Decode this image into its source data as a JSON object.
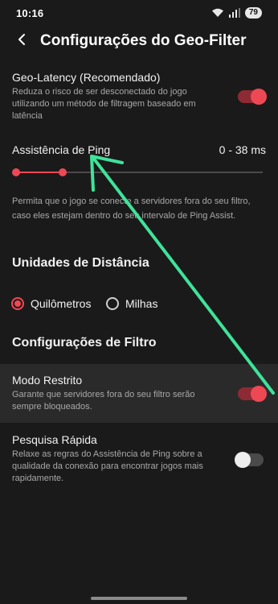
{
  "status": {
    "time": "10:16",
    "battery": "79"
  },
  "header": {
    "title": "Configurações do Geo-Filter"
  },
  "geo_latency": {
    "title": "Geo-Latency (Recomendado)",
    "description": "Reduza o risco de ser desconectado do jogo utilizando um método de filtragem baseado em latência",
    "enabled": true
  },
  "ping_assist": {
    "title": "Assistência de Ping",
    "range_label": "0 - 38 ms",
    "description": "Permita que o jogo se conecte a servidores fora do seu filtro, caso eles estejam dentro do seu intervalo de Ping Assist."
  },
  "distance_units": {
    "title": "Unidades de Distância",
    "options": [
      {
        "label": "Quilômetros",
        "selected": true
      },
      {
        "label": "Milhas",
        "selected": false
      }
    ]
  },
  "filter_settings": {
    "title": "Configurações de Filtro"
  },
  "restricted_mode": {
    "title": "Modo Restrito",
    "description": "Garante que servidores fora do seu filtro serão sempre bloqueados.",
    "enabled": true
  },
  "quick_search": {
    "title": "Pesquisa Rápida",
    "description": "Relaxe as regras do Assistência de Ping sobre a qualidade da conexão para encontrar jogos mais rapidamente.",
    "enabled": false
  },
  "colors": {
    "accent": "#ef4855",
    "arrow": "#3fe39a",
    "background": "#1b1a1a"
  }
}
